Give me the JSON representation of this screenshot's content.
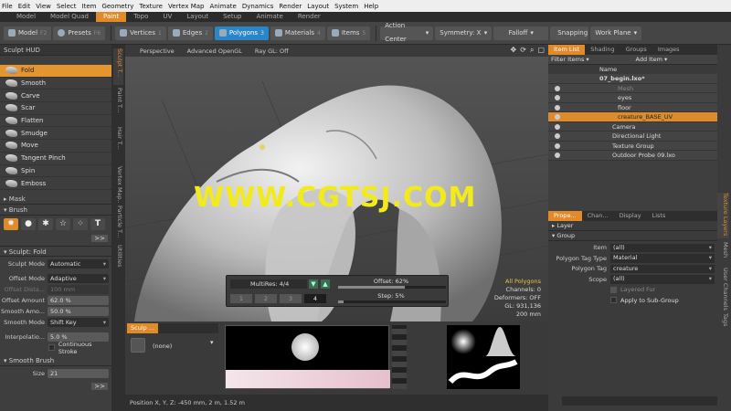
{
  "menubar": [
    "File",
    "Edit",
    "View",
    "Select",
    "Item",
    "Geometry",
    "Texture",
    "Vertex Map",
    "Animate",
    "Dynamics",
    "Render",
    "Layout",
    "System",
    "Help"
  ],
  "tabs": [
    {
      "label": "Model",
      "active": false
    },
    {
      "label": "Model Quad",
      "active": false
    },
    {
      "label": "Paint",
      "active": true
    },
    {
      "label": "Topo",
      "active": false
    },
    {
      "label": "UV",
      "active": false
    },
    {
      "label": "Layout",
      "active": false
    },
    {
      "label": "Setup",
      "active": false
    },
    {
      "label": "Animate",
      "active": false
    },
    {
      "label": "Render",
      "active": false
    }
  ],
  "toolbar": {
    "model": "Model",
    "model_key": "F2",
    "presets": "Presets",
    "presets_key": "F6",
    "vertices": "Vertices",
    "vertices_key": "1",
    "edges": "Edges",
    "edges_key": "2",
    "polygons": "Polygons",
    "polygons_key": "3",
    "materials": "Materials",
    "materials_key": "4",
    "items": "Items",
    "items_key": "5",
    "action_center": "Action Center",
    "symmetry": "Symmetry: X",
    "falloff": "Falloff",
    "snapping": "Snapping",
    "work_plane": "Work Plane"
  },
  "left": {
    "hud": "Sculpt HUD",
    "tools": [
      "Fold",
      "Smooth",
      "Carve",
      "Scar",
      "Flatten",
      "Smudge",
      "Move",
      "Tangent Pinch",
      "Spin",
      "Emboss"
    ],
    "mask": "Mask",
    "brush": "Brush",
    "sculpt_section": "Sculpt: Fold",
    "props": [
      {
        "label": "Sculpt Mode",
        "value": "Automatic",
        "dd": true
      },
      {
        "label": "Offset Mode",
        "value": "Adaptive",
        "dd": true
      },
      {
        "label": "Offset Dista...",
        "value": "100 mm",
        "dim": true
      },
      {
        "label": "Offset Amount",
        "value": "62.0 %",
        "num": true
      },
      {
        "label": "Smooth Amo...",
        "value": "50.0 %",
        "num": true
      },
      {
        "label": "Smooth Mode",
        "value": "Shift Key",
        "dd": true
      },
      {
        "label": "Interpolatio...",
        "value": "5.0 %",
        "num": true
      }
    ],
    "continuous": "Continuous Stroke",
    "smooth_brush": "Smooth Brush",
    "size_label": "Size",
    "size_value": "21",
    "vtabs": [
      "Sculpt T...",
      "Paint T...",
      "Hair T...",
      "Vertex Map...",
      "Particle T...",
      "Utilities"
    ]
  },
  "viewport": {
    "perspective": "Perspective",
    "render_mode": "Advanced OpenGL",
    "ray_gl": "Ray GL: Off",
    "stats": {
      "selection": "All Polygons",
      "channels": "Channels: 0",
      "deformers": "Deformers: OFF",
      "gl": "GL: 931,136",
      "size": "200 mm"
    },
    "multires": "MultiRes: 4/4",
    "levels": [
      "1",
      "2",
      "3",
      "4"
    ],
    "offset_label": "Offset:",
    "offset_value": "62%",
    "offset_fraction": 0.62,
    "step_label": "Step:",
    "step_value": "5%",
    "step_fraction": 0.05,
    "watermark": "WWW.CGTSJ.COM"
  },
  "bottom": {
    "tab": "Sculp ...",
    "none": "(none)",
    "position": "Position X, Y, Z:  -450 mm, 2 m, 1.52 m"
  },
  "right": {
    "tabs": [
      {
        "label": "Item List",
        "active": true
      },
      {
        "label": "Shading"
      },
      {
        "label": "Groups"
      },
      {
        "label": "Images"
      }
    ],
    "filter": "Filter Items",
    "add_item": "Add Item",
    "col_name": "Name",
    "items": [
      {
        "label": "07_begin.lxo*",
        "indent": 56,
        "bold": true
      },
      {
        "label": "Mesh",
        "indent": 76,
        "grey": true
      },
      {
        "label": "eyes",
        "indent": 76
      },
      {
        "label": "floor",
        "indent": 76
      },
      {
        "label": "creature_BASE_UV",
        "indent": 76,
        "selected": true
      },
      {
        "label": "Camera",
        "indent": 70
      },
      {
        "label": "Directional Light",
        "indent": 70
      },
      {
        "label": "Texture Group",
        "indent": 70
      },
      {
        "label": "Outdoor Probe 09.lxo",
        "indent": 70
      }
    ],
    "tabs2": [
      {
        "label": "Prope...",
        "active": true
      },
      {
        "label": "Chan..."
      },
      {
        "label": "Display"
      },
      {
        "label": "Lists"
      }
    ],
    "layer": "Layer",
    "group": "Group",
    "props": [
      {
        "label": "Item",
        "value": "(all)"
      },
      {
        "label": "Polygon Tag Type",
        "value": "Material"
      },
      {
        "label": "Polygon Tag",
        "value": "creature"
      },
      {
        "label": "Scope",
        "value": "(all)"
      }
    ],
    "layered_fur": "Layered Fur",
    "apply_sub": "Apply to Sub-Group",
    "vtabs": [
      "Texture Layers",
      "Mesh",
      "User Channels",
      "Tags"
    ]
  }
}
